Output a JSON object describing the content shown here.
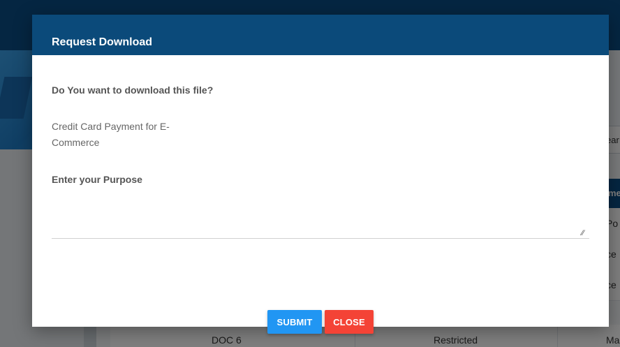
{
  "background": {
    "search_partial": "ear",
    "table_header_partial": "me",
    "rows": [
      {
        "c3": "Po"
      },
      {
        "c3": "ce"
      },
      {
        "c3": "ce"
      },
      {
        "c1": "DOC 6",
        "c2": "Restricted",
        "c3": "Ma"
      }
    ]
  },
  "modal": {
    "title": "Request Download",
    "question": "Do You want to download this file?",
    "file_name": "Credit Card Payment for E-Commerce",
    "purpose_label": "Enter your Purpose",
    "purpose_value": "",
    "submit_label": "SUBMIT",
    "close_label": "CLOSE"
  },
  "colors": {
    "header": "#0b4a7a",
    "submit": "#2196f3",
    "close": "#f44336"
  }
}
